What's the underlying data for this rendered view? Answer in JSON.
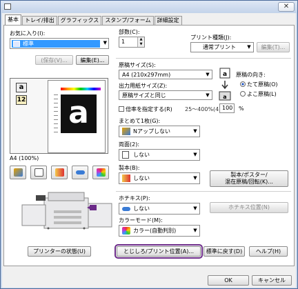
{
  "window": {
    "title": ""
  },
  "tabs": [
    {
      "label": "基本",
      "active": true
    },
    {
      "label": "トレイ/排出",
      "active": false
    },
    {
      "label": "グラフィックス",
      "active": false
    },
    {
      "label": "スタンプ/フォーム",
      "active": false
    },
    {
      "label": "詳細設定",
      "active": false
    }
  ],
  "favorites": {
    "label": "お気に入り(I):",
    "selected": "標準",
    "save_button": "(保存(V)...",
    "edit_button": "編集(E)..."
  },
  "preview": {
    "caption": "A4 (100%)"
  },
  "copies": {
    "label": "部数(C):",
    "value": "1"
  },
  "print_type": {
    "label": "プリント種類(J):",
    "value": "通常プリント",
    "setup_button": "編集(T)..."
  },
  "original_size": {
    "label": "原稿サイズ(S):",
    "value": "A4 (210x297mm)"
  },
  "output_size": {
    "label": "出力用紙サイズ(Z):",
    "value": "原稿サイズと同じ"
  },
  "orientation": {
    "label": "原稿の向き:",
    "options": [
      {
        "label": "たて原稿(O)",
        "selected": true
      },
      {
        "label": "よこ原稿(L)",
        "selected": false
      }
    ]
  },
  "scale": {
    "checkbox_label": "倍率を指定する(R)",
    "range_label": "25～400%(4):",
    "value": "100",
    "unit": "%"
  },
  "nup": {
    "label": "まとめて1枚(G):",
    "value": "Nアップしない"
  },
  "duplex": {
    "label": "両面(2):",
    "value": "しない"
  },
  "booklet": {
    "label": "製本(B):",
    "value": "しない",
    "button": "製本/ポスター/\n混在原稿/回転(K)..."
  },
  "staple": {
    "label": "ホチキス(P):",
    "value": "しない",
    "button": "ホチキス位置(N)"
  },
  "color_mode": {
    "label": "カラーモード(M):",
    "value": "カラー(自動判別)"
  },
  "bottom": {
    "printer_status": "プリンターの状態(U)",
    "margin_position": "とじしろ/プリント位置(A)...",
    "restore_default": "標準に戻す(D)",
    "help": "ヘルプ(H)"
  },
  "dialog": {
    "ok": "OK",
    "cancel": "キャンセル"
  },
  "colors": {
    "highlight": "#6b2a88",
    "selection": "#3399ff"
  }
}
